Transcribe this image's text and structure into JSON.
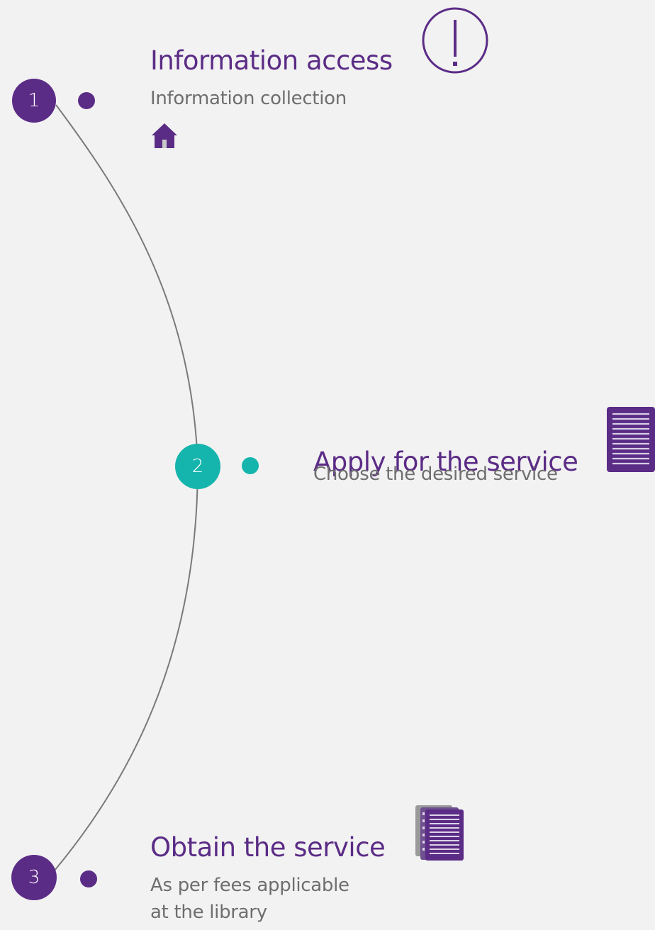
{
  "colors": {
    "primary": "#5b2c86",
    "accent": "#15b5ad",
    "line": "#7a7a7a",
    "subtitle": "#6e6e6e",
    "background": "#f2f2f2"
  },
  "steps": [
    {
      "number": "1",
      "title": "Information access",
      "subtitle_lines": [
        "Information collection"
      ],
      "icon": "info-icon",
      "secondary_icon": "home-icon",
      "color": "#5b2c86"
    },
    {
      "number": "2",
      "title": "Apply for the service",
      "subtitle_lines": [
        "Choose the desired service"
      ],
      "icon": "document-icon",
      "color": "#15b5ad"
    },
    {
      "number": "3",
      "title": "Obtain the service",
      "subtitle_lines": [
        "As per fees applicable",
        "at the library"
      ],
      "icon": "documents-stack-icon",
      "color": "#5b2c86"
    }
  ]
}
